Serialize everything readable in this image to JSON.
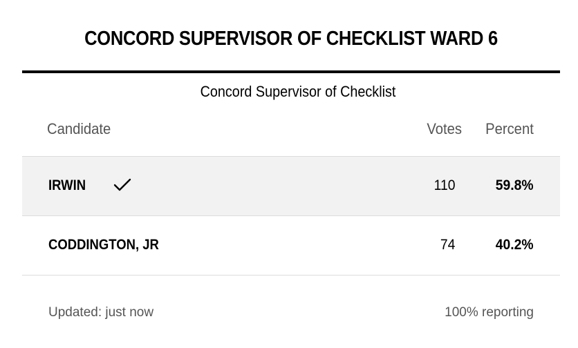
{
  "header": {
    "title": "CONCORD SUPERVISOR OF CHECKLIST WARD 6"
  },
  "race": {
    "name": "Concord Supervisor of Checklist"
  },
  "table": {
    "columns": {
      "candidate": "Candidate",
      "votes": "Votes",
      "percent": "Percent"
    },
    "rows": [
      {
        "name": "IRWIN",
        "votes": "110",
        "percent": "59.8%",
        "winner": true,
        "winner_icon": "checkmark-icon"
      },
      {
        "name": "CODDINGTON, JR",
        "votes": "74",
        "percent": "40.2%",
        "winner": false
      }
    ]
  },
  "footer": {
    "updated": "Updated: just now",
    "reporting": "100% reporting"
  },
  "colors": {
    "winner_row_bg": "#f2f2f2",
    "muted_text": "#555555",
    "rule": "#000000",
    "divider": "#dcdcdc"
  }
}
